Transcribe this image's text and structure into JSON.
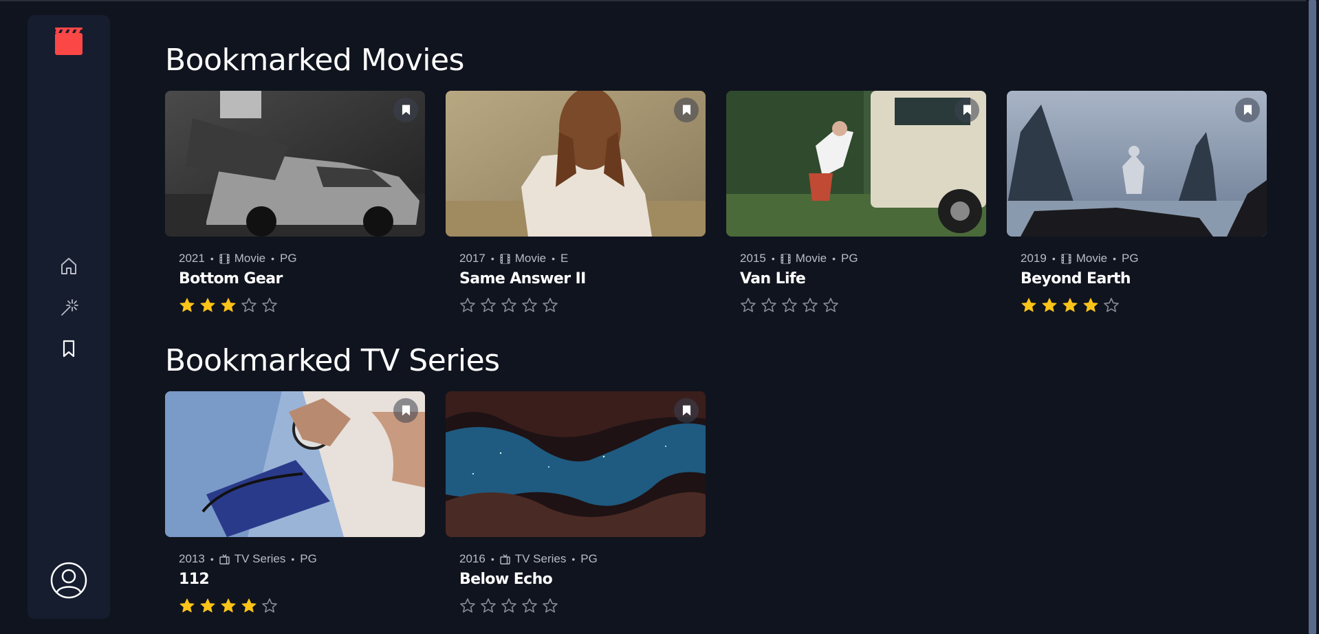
{
  "colors": {
    "accent": "#fc4747",
    "background": "#10141e",
    "sidebar": "#161d2f",
    "star": "#fcc419",
    "muted": "#b8bcc6"
  },
  "nav": {
    "logo_icon": "clapperboard-icon",
    "items": [
      {
        "icon": "home-icon"
      },
      {
        "icon": "magic-wand-icon"
      },
      {
        "icon": "bookmark-icon"
      }
    ],
    "avatar_icon": "user-avatar-icon"
  },
  "sections": [
    {
      "title": "Bookmarked Movies",
      "items": [
        {
          "year": "2021",
          "category": "Movie",
          "rating": "PG",
          "title": "Bottom Gear",
          "stars": 3
        },
        {
          "year": "2017",
          "category": "Movie",
          "rating": "E",
          "title": "Same Answer II",
          "stars": 0
        },
        {
          "year": "2015",
          "category": "Movie",
          "rating": "PG",
          "title": "Van Life",
          "stars": 0
        },
        {
          "year": "2019",
          "category": "Movie",
          "rating": "PG",
          "title": "Beyond Earth",
          "stars": 4
        }
      ]
    },
    {
      "title": "Bookmarked TV Series",
      "items": [
        {
          "year": "2013",
          "category": "TV Series",
          "rating": "PG",
          "title": "112",
          "stars": 4
        },
        {
          "year": "2016",
          "category": "TV Series",
          "rating": "PG",
          "title": "Below Echo",
          "stars": 0
        }
      ]
    }
  ]
}
